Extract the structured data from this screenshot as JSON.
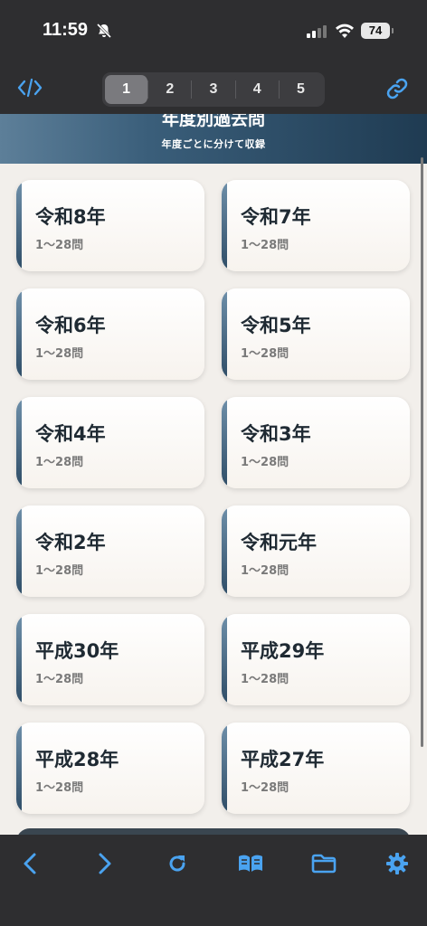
{
  "status": {
    "time": "11:59",
    "battery": "74"
  },
  "toolbar": {
    "pages": [
      "1",
      "2",
      "3",
      "4",
      "5"
    ],
    "active_page": "1"
  },
  "header": {
    "title": "年度別過去問",
    "subtitle": "年度ごとに分けて収録"
  },
  "cards": [
    {
      "title": "令和8年",
      "sub": "1〜28問"
    },
    {
      "title": "令和7年",
      "sub": "1〜28問"
    },
    {
      "title": "令和6年",
      "sub": "1〜28問"
    },
    {
      "title": "令和5年",
      "sub": "1〜28問"
    },
    {
      "title": "令和4年",
      "sub": "1〜28問"
    },
    {
      "title": "令和3年",
      "sub": "1〜28問"
    },
    {
      "title": "令和2年",
      "sub": "1〜28問"
    },
    {
      "title": "令和元年",
      "sub": "1〜28問"
    },
    {
      "title": "平成30年",
      "sub": "1〜28問"
    },
    {
      "title": "平成29年",
      "sub": "1〜28問"
    },
    {
      "title": "平成28年",
      "sub": "1〜28問"
    },
    {
      "title": "平成27年",
      "sub": "1〜28問"
    }
  ],
  "colors": {
    "accent": "#4aa3f0",
    "bar": "#2e2e30",
    "header_dark": "#1f3b52"
  },
  "icons": [
    "code-icon",
    "link-icon",
    "back-icon",
    "forward-icon",
    "reload-icon",
    "book-icon",
    "folder-icon",
    "gear-icon"
  ]
}
